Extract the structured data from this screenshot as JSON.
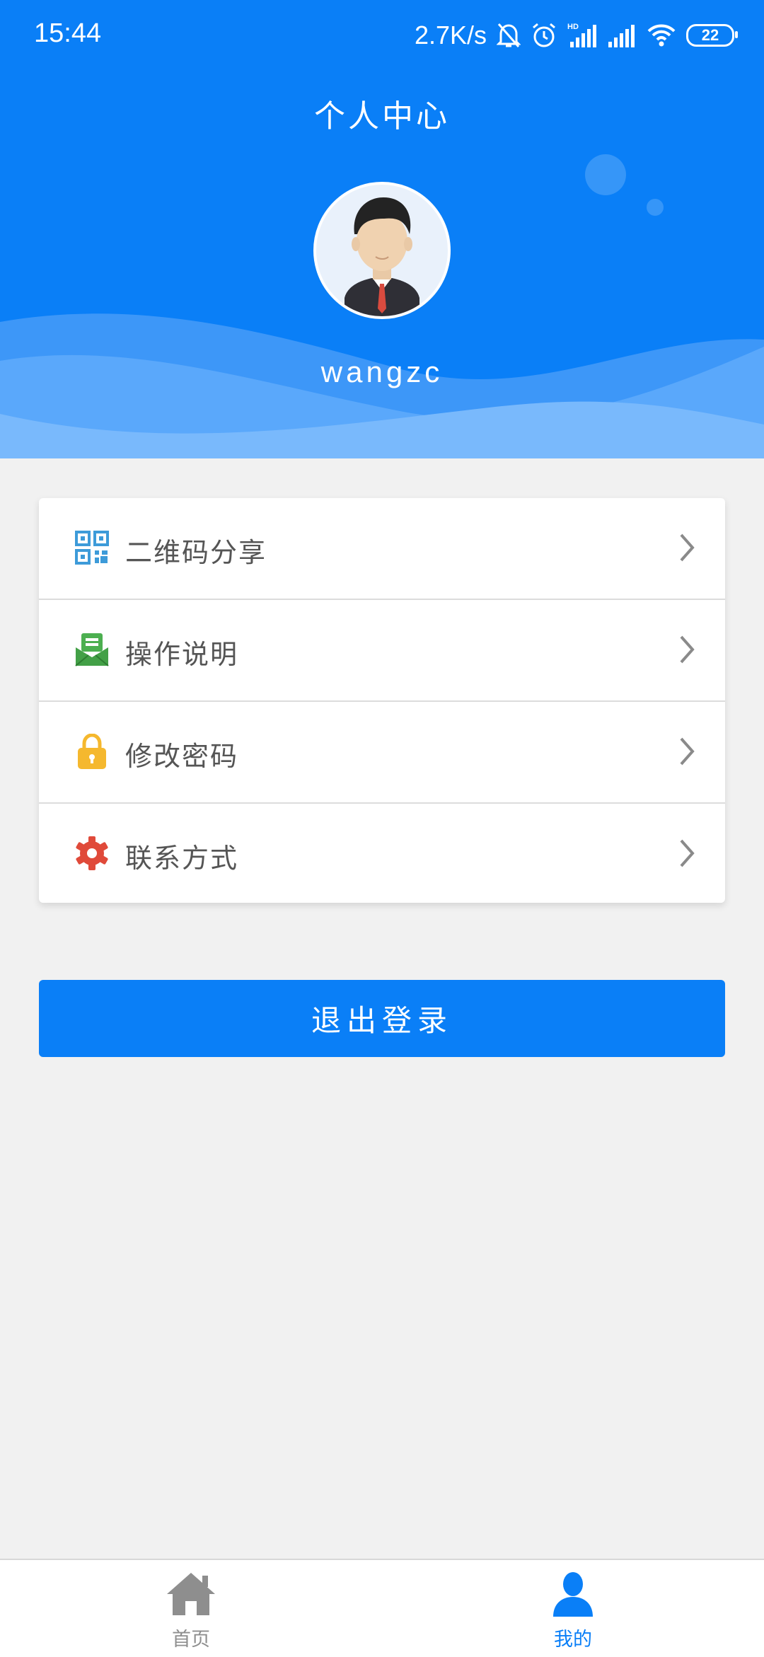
{
  "status_bar": {
    "time": "15:44",
    "net_speed": "2.7K/s",
    "battery": "22",
    "icons": [
      "bell-muted-icon",
      "alarm-icon",
      "hd-signal-icon",
      "signal-icon",
      "wifi-icon",
      "battery-icon"
    ]
  },
  "header": {
    "title": "个人中心",
    "username": "wangzc",
    "avatar": "avatar-man-icon",
    "colors": {
      "primary": "#0a7ff7",
      "wave_light": "#5aa8fb",
      "wave_lighter": "#79b9fc"
    }
  },
  "menu": {
    "items": [
      {
        "label": "二维码分享",
        "icon": "qrcode-icon",
        "icon_color": "#3d9bd9"
      },
      {
        "label": "操作说明",
        "icon": "mail-doc-icon",
        "icon_color": "#4caf50"
      },
      {
        "label": "修改密码",
        "icon": "lock-icon",
        "icon_color": "#f5b82e"
      },
      {
        "label": "联系方式",
        "icon": "gear-icon",
        "icon_color": "#e04a3a"
      }
    ]
  },
  "logout": {
    "label": "退出登录"
  },
  "bottom_nav": {
    "items": [
      {
        "label": "首页",
        "icon": "home-icon",
        "active": false,
        "color": "#8e8e8e"
      },
      {
        "label": "我的",
        "icon": "user-icon",
        "active": true,
        "color": "#0a7ff7"
      }
    ]
  }
}
